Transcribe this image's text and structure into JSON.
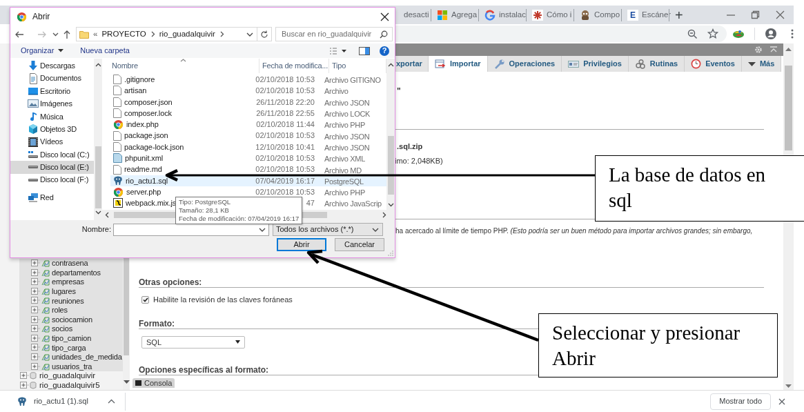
{
  "browser_tabs": [
    {
      "label": "desacti"
    },
    {
      "label": "Agrega",
      "kind": "squares"
    },
    {
      "label": "instalac",
      "kind": "ring"
    },
    {
      "label": "Cómo i",
      "kind": "asterisk"
    },
    {
      "label": "Compo",
      "kind": "figure"
    },
    {
      "label": "Escáner",
      "kind": "letter",
      "glyph": "E"
    }
  ],
  "new_tab": "+",
  "pma_tabs": [
    {
      "label": "xportar",
      "selected": false
    },
    {
      "label": "Importar",
      "kind": "import",
      "selected": true
    },
    {
      "label": "Operaciones",
      "kind": "wrench",
      "selected": false
    },
    {
      "label": "Privilegios",
      "kind": "card",
      "selected": false
    },
    {
      "label": "Rutinas",
      "kind": "gears",
      "selected": false
    },
    {
      "label": "Eventos",
      "kind": "clock",
      "selected": false
    },
    {
      "label": "Más",
      "kind": "caret",
      "selected": false
    }
  ],
  "import_page": {
    "quote_fragment": "\"",
    "file_hint": ".sql.zip",
    "max_size": "imo: 2,048KB)",
    "timeout_note": "ha acercado al límite de tiempo PHP. *(Esto podría ser un buen método para importar archivos grandes; sin embargo,*",
    "other_options": {
      "heading": "Otras opciones:",
      "checkbox": {
        "label": "Habilite la revisión de las claves foráneas",
        "checked": true
      }
    },
    "format": {
      "heading": "Formato:",
      "value": "SQL"
    },
    "format_options_heading": "Opciones específicas al formato:",
    "console_tab": "Consola"
  },
  "nav_tree": {
    "tables": [
      "contrasena",
      "departamentos",
      "empresas",
      "lugares",
      "reuniones",
      "roles",
      "sociocamion",
      "socios",
      "tipo_camion",
      "tipo_carga",
      "unidades_de_medida",
      "usuarios_tra"
    ],
    "databases": [
      "rio_guadalquivir",
      "rio_guadalquivir5"
    ]
  },
  "dialog": {
    "title": "Abrir",
    "breadcrumb": {
      "prefix": "«",
      "segments": [
        "PROYECTO",
        "rio_guadalquivir"
      ]
    },
    "search": {
      "placeholder": "Buscar en rio_guadalquivir"
    },
    "toolbar": {
      "organize": "Organizar",
      "new_folder": "Nueva carpeta",
      "help": "?"
    },
    "places": [
      {
        "label": "Descargas",
        "kind": "download",
        "selected": false
      },
      {
        "label": "Documentos",
        "kind": "documents",
        "selected": false
      },
      {
        "label": "Escritorio",
        "kind": "desktop",
        "selected": false
      },
      {
        "label": "Imágenes",
        "kind": "images",
        "selected": false
      },
      {
        "label": "Música",
        "kind": "music",
        "selected": false
      },
      {
        "label": "Objetos 3D",
        "kind": "cube",
        "selected": false
      },
      {
        "label": "Vídeos",
        "kind": "videos",
        "selected": false
      },
      {
        "label": "Disco local (C:)",
        "kind": "system_drive",
        "selected": false
      },
      {
        "label": "Disco local (E:)",
        "kind": "drive",
        "selected": true
      },
      {
        "label": "Disco local (F:)",
        "kind": "drive",
        "selected": false
      },
      {
        "label": "Red",
        "kind": "network",
        "selected": false
      }
    ],
    "columns": [
      "Nombre",
      "Fecha de modifica...",
      "Tipo"
    ],
    "files": [
      {
        "name": ".gitignore",
        "date": "02/10/2018 10:53",
        "type": "Archivo GITIGNO",
        "kind": "file",
        "selected": false
      },
      {
        "name": "artisan",
        "date": "02/10/2018 10:53",
        "type": "Archivo",
        "kind": "file",
        "selected": false
      },
      {
        "name": "composer.json",
        "date": "26/11/2018 22:20",
        "type": "Archivo JSON",
        "kind": "file",
        "selected": false
      },
      {
        "name": "composer.lock",
        "date": "26/11/2018 22:55",
        "type": "Archivo LOCK",
        "kind": "file",
        "selected": false
      },
      {
        "name": "index.php",
        "date": "02/10/2018 11:44",
        "type": "Archivo PHP",
        "kind": "browser",
        "selected": false
      },
      {
        "name": "package.json",
        "date": "02/10/2018 10:53",
        "type": "Archivo JSON",
        "kind": "file",
        "selected": false
      },
      {
        "name": "package-lock.json",
        "date": "12/10/2018 10:41",
        "type": "Archivo JSON",
        "kind": "file",
        "selected": false
      },
      {
        "name": "phpunit.xml",
        "date": "02/10/2018 10:53",
        "type": "Archivo XML",
        "kind": "xml",
        "selected": false
      },
      {
        "name": "readme.md",
        "date": "02/10/2018 10:53",
        "type": "Archivo MD",
        "kind": "file",
        "selected": false
      },
      {
        "name": "rio_actu1.sql",
        "date": "07/04/2019 16:17",
        "type": "PostgreSQL",
        "kind": "postgres",
        "selected": true
      },
      {
        "name": "server.php",
        "date": "02/10/2018 10:53",
        "type": "Archivo PHP",
        "kind": "browser",
        "selected": false
      },
      {
        "name": "webpack.mix.js",
        "date": "47",
        "type": "Archivo JavaScrip",
        "kind": "script",
        "selected": false
      }
    ],
    "tooltip": [
      "Tipo: PostgreSQL",
      "Tamaño: 28,1 KB",
      "Fecha de modificación: 07/04/2019 16:17"
    ],
    "filename_label": "Nombre:",
    "filter": "Todos los archivos (*.*)",
    "buttons": [
      {
        "label": "Abrir",
        "kind": "primary"
      },
      {
        "label": "Cancelar",
        "kind": "secondary"
      }
    ]
  },
  "download_bar": {
    "file": "rio_actu1 (1).sql",
    "show_all": "Mostrar todo"
  },
  "callouts": [
    {
      "text": "La base de datos en sql"
    },
    {
      "text": "Seleccionar y presionar Abrir"
    }
  ]
}
